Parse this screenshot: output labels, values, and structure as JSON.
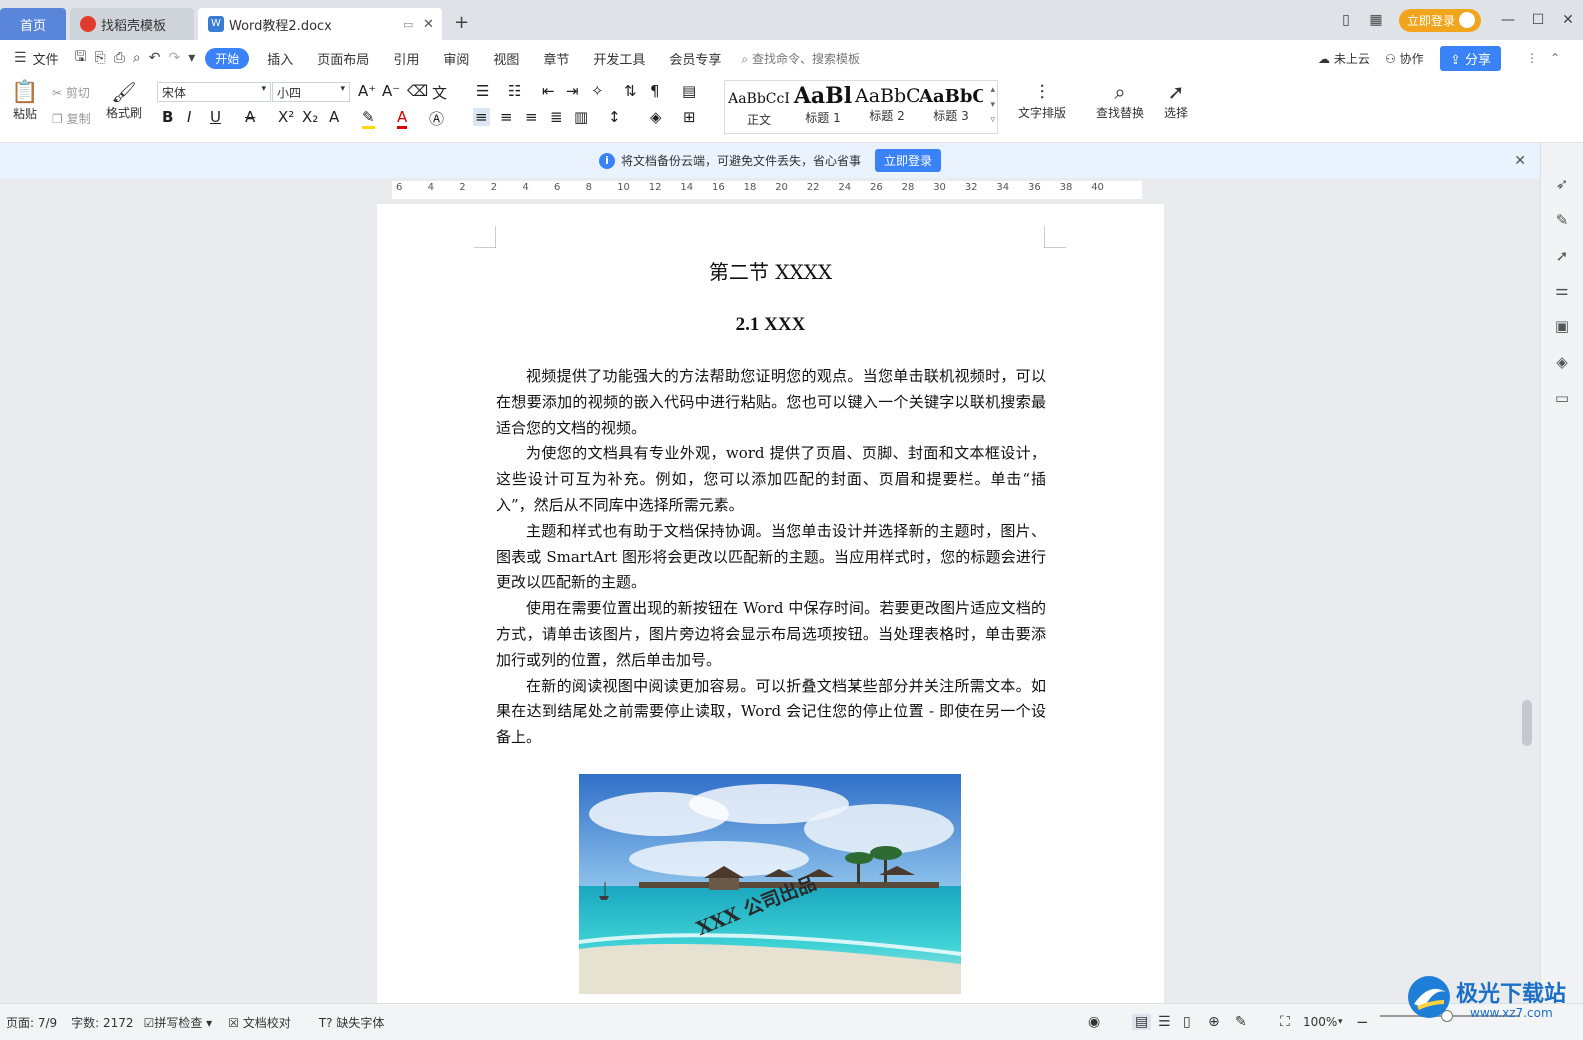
{
  "tabs": {
    "home": "首页",
    "templates": "找稻壳模板",
    "document": "Word教程2.docx"
  },
  "titlebar": {
    "login": "立即登录",
    "new_tab": "+",
    "close_tab": "✕"
  },
  "menu": {
    "file": "文件",
    "items": [
      "开始",
      "插入",
      "页面布局",
      "引用",
      "审阅",
      "视图",
      "章节",
      "开发工具",
      "会员专享"
    ],
    "search_placeholder": "查找命令、搜索模板",
    "cloud": "未上云",
    "collab": "协作",
    "share": "分享"
  },
  "ribbon": {
    "paste": "粘贴",
    "cut": "剪切",
    "copy": "复制",
    "format_painter": "格式刷",
    "font_name": "宋体",
    "font_size": "小四",
    "styles": [
      {
        "sample": "AaBbCcI",
        "name": "正文"
      },
      {
        "sample": "AaBl",
        "name": "标题 1"
      },
      {
        "sample": "AaBbC",
        "name": "标题 2"
      },
      {
        "sample": "AaBbC",
        "name": "标题 3"
      }
    ],
    "text_layout": "文字排版",
    "find_replace": "查找替换",
    "select": "选择"
  },
  "notice": {
    "message": "将文档备份云端，可避免文件丢失，省心省事",
    "login": "立即登录"
  },
  "ruler": {
    "h_ticks": [
      "6",
      "4",
      "2",
      "2",
      "4",
      "6",
      "8",
      "10",
      "12",
      "14",
      "16",
      "18",
      "20",
      "22",
      "24",
      "26",
      "28",
      "30",
      "32",
      "34",
      "36",
      "38",
      "40"
    ]
  },
  "document": {
    "heading": "第二节 XXXX",
    "subheading": "2.1 XXX",
    "paragraphs": [
      "视频提供了功能强大的方法帮助您证明您的观点。当您单击联机视频时，可以在想要添加的视频的嵌入代码中进行粘贴。您也可以键入一个关键字以联机搜索最适合您的文档的视频。",
      "为使您的文档具有专业外观，word 提供了页眉、页脚、封面和文本框设计，这些设计可互为补充。例如，您可以添加匹配的封面、页眉和提要栏。单击“插入”，然后从不同库中选择所需元素。",
      "主题和样式也有助于文档保持协调。当您单击设计并选择新的主题时，图片、图表或 SmartArt 图形将会更改以匹配新的主题。当应用样式时，您的标题会进行更改以匹配新的主题。",
      "使用在需要位置出现的新按钮在 Word 中保存时间。若要更改图片适应文档的方式，请单击该图片，图片旁边将会显示布局选项按钮。当处理表格时，单击要添加行或列的位置，然后单击加号。",
      "在新的阅读视图中阅读更加容易。可以折叠文档某些部分并关注所需文本。如果在达到结尾处之前需要停止读取，Word 会记住您的停止位置 - 即使在另一个设备上。"
    ],
    "watermark": "XXX 公司出品"
  },
  "status": {
    "page": "页面: 7/9",
    "words": "字数: 2172",
    "spell": "拼写检查",
    "proof": "文档校对",
    "missing_font": "缺失字体",
    "zoom": "100%"
  },
  "brand": {
    "name": "极光下载站",
    "url": "www.xz7.com"
  },
  "colors": {
    "accent": "#3a82f7",
    "login": "#f0a51c",
    "home_tab": "#5a86d9"
  }
}
